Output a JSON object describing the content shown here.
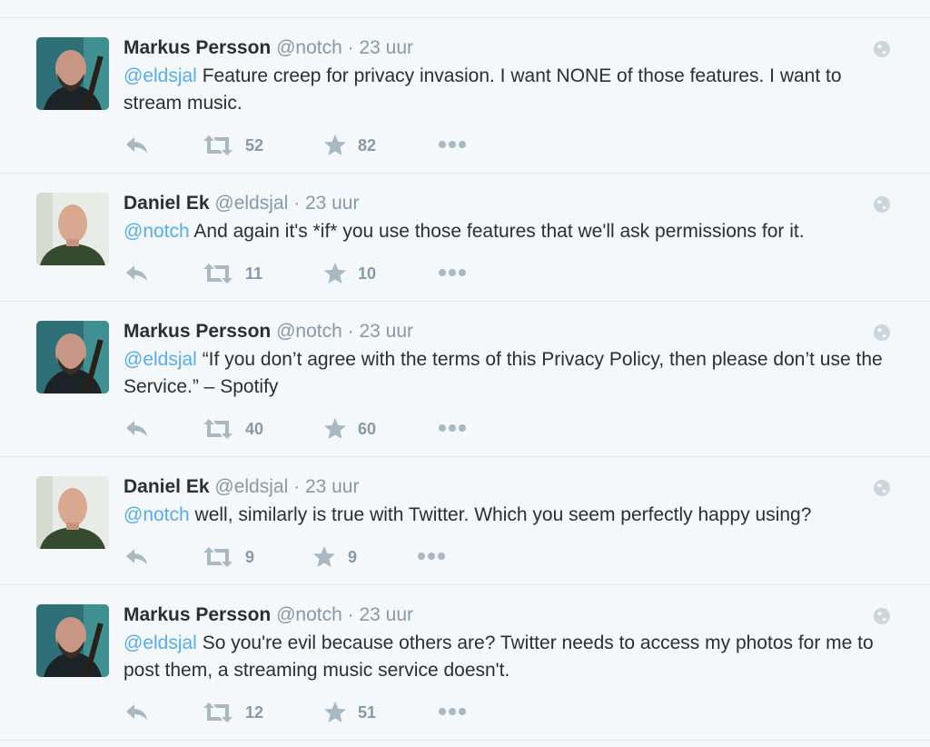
{
  "colors": {
    "background": "#f5f8fa",
    "mention": "#55acee",
    "muted": "#8899a6",
    "text": "#292f33",
    "divider": "#e1e8ed"
  },
  "icons": {
    "reply": "reply-icon",
    "retweet": "retweet-icon",
    "favorite": "star-icon",
    "more": "more-icon",
    "public": "globe-icon"
  },
  "tweets": [
    {
      "name": "Markus Persson",
      "handle": "@notch",
      "sep": "·",
      "time": "23 uur",
      "mention": "@eldsjal",
      "text": " Feature creep for privacy invasion. I want NONE of those features. I want to stream music.",
      "retweets": "52",
      "favorites": "82",
      "avatar": "markus"
    },
    {
      "name": "Daniel Ek",
      "handle": "@eldsjal",
      "sep": "·",
      "time": "23 uur",
      "mention": "@notch",
      "text": " And again it's *if* you use those features that we'll ask permissions for it.",
      "retweets": "11",
      "favorites": "10",
      "avatar": "daniel"
    },
    {
      "name": "Markus Persson",
      "handle": "@notch",
      "sep": "·",
      "time": "23 uur",
      "mention": "@eldsjal",
      "text": " “If you don’t agree with the terms of this Privacy Policy, then please don’t use the Service.” – Spotify",
      "retweets": "40",
      "favorites": "60",
      "avatar": "markus"
    },
    {
      "name": "Daniel Ek",
      "handle": "@eldsjal",
      "sep": "·",
      "time": "23 uur",
      "mention": "@notch",
      "text": " well, similarly is true with Twitter. Which you seem perfectly happy using?",
      "retweets": "9",
      "favorites": "9",
      "avatar": "daniel"
    },
    {
      "name": "Markus Persson",
      "handle": "@notch",
      "sep": "·",
      "time": "23 uur",
      "mention": "@eldsjal",
      "text": " So you're evil because others are? Twitter needs to access my photos for me to post them, a streaming music service doesn't.",
      "retweets": "12",
      "favorites": "51",
      "avatar": "markus"
    }
  ]
}
